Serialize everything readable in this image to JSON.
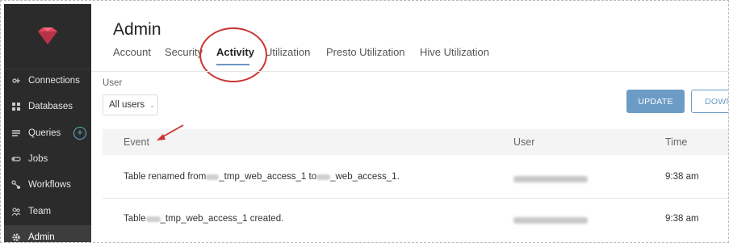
{
  "sidebar": {
    "items": [
      {
        "label": "Connections",
        "icon": "connections-icon"
      },
      {
        "label": "Databases",
        "icon": "databases-icon"
      },
      {
        "label": "Queries",
        "icon": "queries-icon"
      },
      {
        "label": "Jobs",
        "icon": "jobs-icon"
      },
      {
        "label": "Workflows",
        "icon": "workflows-icon"
      },
      {
        "label": "Team",
        "icon": "team-icon"
      },
      {
        "label": "Admin",
        "icon": "gear-icon"
      }
    ],
    "add_query_symbol": "+"
  },
  "page": {
    "title": "Admin"
  },
  "tabs": [
    "Account",
    "Security",
    "Activity",
    "Utilization",
    "Presto Utilization",
    "Hive Utilization"
  ],
  "active_tab": "Activity",
  "filter": {
    "label": "User",
    "selected": "All users"
  },
  "buttons": {
    "update": "UPDATE",
    "download": "DOWNLOAD"
  },
  "table": {
    "columns": [
      "Event",
      "User",
      "Time"
    ],
    "rows": [
      {
        "event_prefix": "Table renamed from ",
        "event_mid1": "_tmp_web_access_1 to ",
        "event_mid2": "_web_access_1.",
        "time": "9:38 am"
      },
      {
        "event_prefix": "Table ",
        "event_mid1": "_tmp_web_access_1 created.",
        "time": "9:38 am"
      }
    ]
  },
  "colors": {
    "sidebar_bg": "#2b2b2b",
    "accent": "#6c9cc6",
    "annotation": "#cc3333",
    "logo": "#e0475a"
  }
}
